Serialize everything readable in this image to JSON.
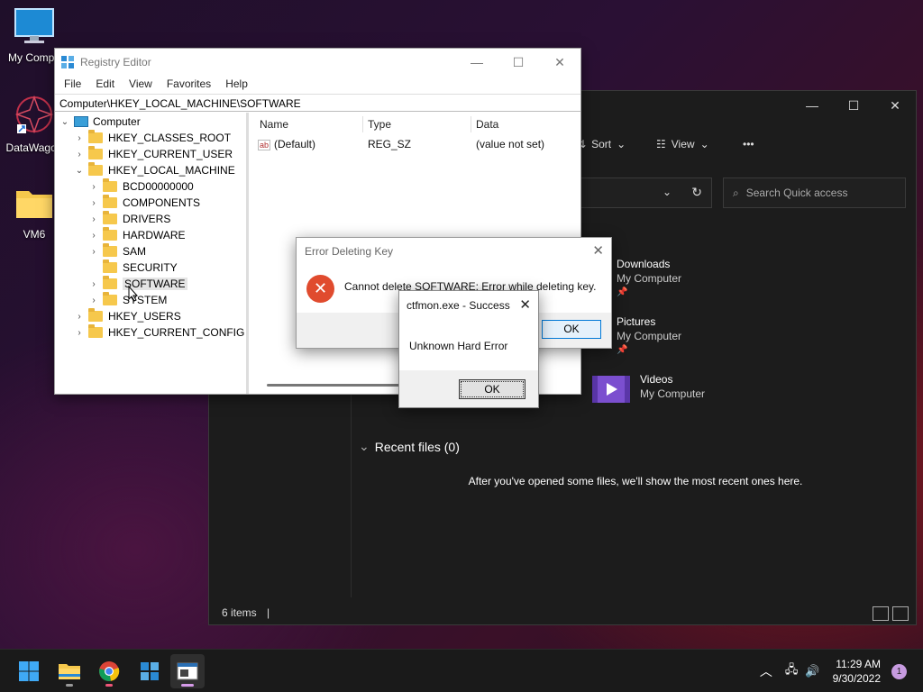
{
  "desktop": {
    "icons": [
      {
        "label": "My Compu"
      },
      {
        "label": "DataWagon"
      },
      {
        "label": "VM6"
      }
    ]
  },
  "explorer": {
    "toolbar": {
      "sort": "Sort",
      "view": "View",
      "more": "•••"
    },
    "search_placeholder": "Search Quick access",
    "quick_access": [
      {
        "name": "Downloads",
        "location": "My Computer"
      },
      {
        "name": "Pictures",
        "location": "My Computer"
      },
      {
        "name": "Videos",
        "location": "My Computer"
      }
    ],
    "recent_header": "Recent files (0)",
    "recent_message": "After you've opened some files, we'll show the most recent ones here.",
    "status": "6 items"
  },
  "regedit": {
    "title": "Registry Editor",
    "menu": [
      "File",
      "Edit",
      "View",
      "Favorites",
      "Help"
    ],
    "address": "Computer\\HKEY_LOCAL_MACHINE\\SOFTWARE",
    "tree": {
      "root": "Computer",
      "hkcr": "HKEY_CLASSES_ROOT",
      "hkcu": "HKEY_CURRENT_USER",
      "hklm": "HKEY_LOCAL_MACHINE",
      "bcd": "BCD00000000",
      "components": "COMPONENTS",
      "drivers": "DRIVERS",
      "hardware": "HARDWARE",
      "sam": "SAM",
      "security": "SECURITY",
      "software": "SOFTWARE",
      "system": "SYSTEM",
      "hku": "HKEY_USERS",
      "hkcc": "HKEY_CURRENT_CONFIG"
    },
    "columns": {
      "name": "Name",
      "type": "Type",
      "data": "Data"
    },
    "value_row": {
      "name": "(Default)",
      "type": "REG_SZ",
      "data": "(value not set)"
    }
  },
  "error_dialog": {
    "title": "Error Deleting Key",
    "message": "Cannot delete SOFTWARE:  Error while deleting key.",
    "ok": "OK"
  },
  "success_dialog": {
    "title": "ctfmon.exe - Success",
    "message": "Unknown Hard Error",
    "ok": "OK"
  },
  "taskbar": {
    "time": "11:29 AM",
    "date": "9/30/2022",
    "notifications": "1"
  },
  "colors": {
    "accent": "#0078d7",
    "error": "#e04b2e",
    "folder": "#f6c84c"
  }
}
